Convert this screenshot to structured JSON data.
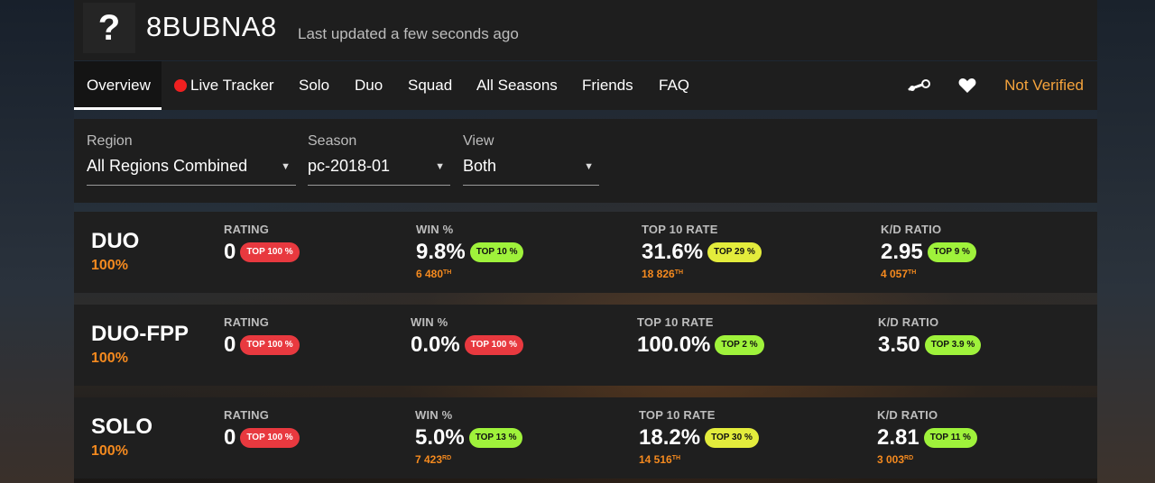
{
  "colors": {
    "accent_orange": "#f58a1f",
    "not_verified": "#f5a33c",
    "badge_red": "#e8393f",
    "badge_green": "#9ff23b",
    "badge_yellow": "#e3ec3c",
    "live_dot": "#f02020"
  },
  "profile": {
    "avatar_glyph": "?",
    "name": "8BUBNA8",
    "last_updated": "Last updated a few seconds ago"
  },
  "nav": {
    "items": [
      {
        "label": "Overview",
        "active": true
      },
      {
        "label": "Live Tracker",
        "active": false
      },
      {
        "label": "Solo",
        "active": false
      },
      {
        "label": "Duo",
        "active": false
      },
      {
        "label": "Squad",
        "active": false
      },
      {
        "label": "All Seasons",
        "active": false
      },
      {
        "label": "Friends",
        "active": false
      },
      {
        "label": "FAQ",
        "active": false
      }
    ],
    "icons": [
      "steam-icon",
      "heart-icon"
    ],
    "verify_label": "Not Verified"
  },
  "filters": {
    "region": {
      "label": "Region",
      "value": "All Regions Combined"
    },
    "season": {
      "label": "Season",
      "value": "pc-2018-01"
    },
    "view": {
      "label": "View",
      "value": "Both"
    }
  },
  "modes": [
    {
      "name": "DUO",
      "percent": "100%",
      "rating": {
        "label": "RATING",
        "value": "0",
        "badge": "TOP 100 %",
        "badge_color": "red"
      },
      "win": {
        "label": "WIN %",
        "value": "9.8%",
        "badge": "TOP 10 %",
        "badge_color": "green",
        "rank": "6 480",
        "rank_suffix": "TH"
      },
      "top10": {
        "label": "TOP 10 RATE",
        "value": "31.6%",
        "badge": "TOP 29 %",
        "badge_color": "yellow",
        "rank": "18 826",
        "rank_suffix": "TH"
      },
      "kd": {
        "label": "K/D RATIO",
        "value": "2.95",
        "badge": "TOP 9 %",
        "badge_color": "green",
        "rank": "4 057",
        "rank_suffix": "TH"
      }
    },
    {
      "name": "DUO-FPP",
      "percent": "100%",
      "rating": {
        "label": "RATING",
        "value": "0",
        "badge": "TOP 100 %",
        "badge_color": "red"
      },
      "win": {
        "label": "WIN %",
        "value": "0.0%",
        "badge": "TOP 100 %",
        "badge_color": "red"
      },
      "top10": {
        "label": "TOP 10 RATE",
        "value": "100.0%",
        "badge": "TOP 2 %",
        "badge_color": "green"
      },
      "kd": {
        "label": "K/D RATIO",
        "value": "3.50",
        "badge": "TOP 3.9 %",
        "badge_color": "green"
      }
    },
    {
      "name": "SOLO",
      "percent": "100%",
      "rating": {
        "label": "RATING",
        "value": "0",
        "badge": "TOP 100 %",
        "badge_color": "red"
      },
      "win": {
        "label": "WIN %",
        "value": "5.0%",
        "badge": "TOP 13 %",
        "badge_color": "green",
        "rank": "7 423",
        "rank_suffix": "RD"
      },
      "top10": {
        "label": "TOP 10 RATE",
        "value": "18.2%",
        "badge": "TOP 30 %",
        "badge_color": "yellow",
        "rank": "14 516",
        "rank_suffix": "TH"
      },
      "kd": {
        "label": "K/D RATIO",
        "value": "2.81",
        "badge": "TOP 11 %",
        "badge_color": "green",
        "rank": "3 003",
        "rank_suffix": "RD"
      }
    }
  ]
}
